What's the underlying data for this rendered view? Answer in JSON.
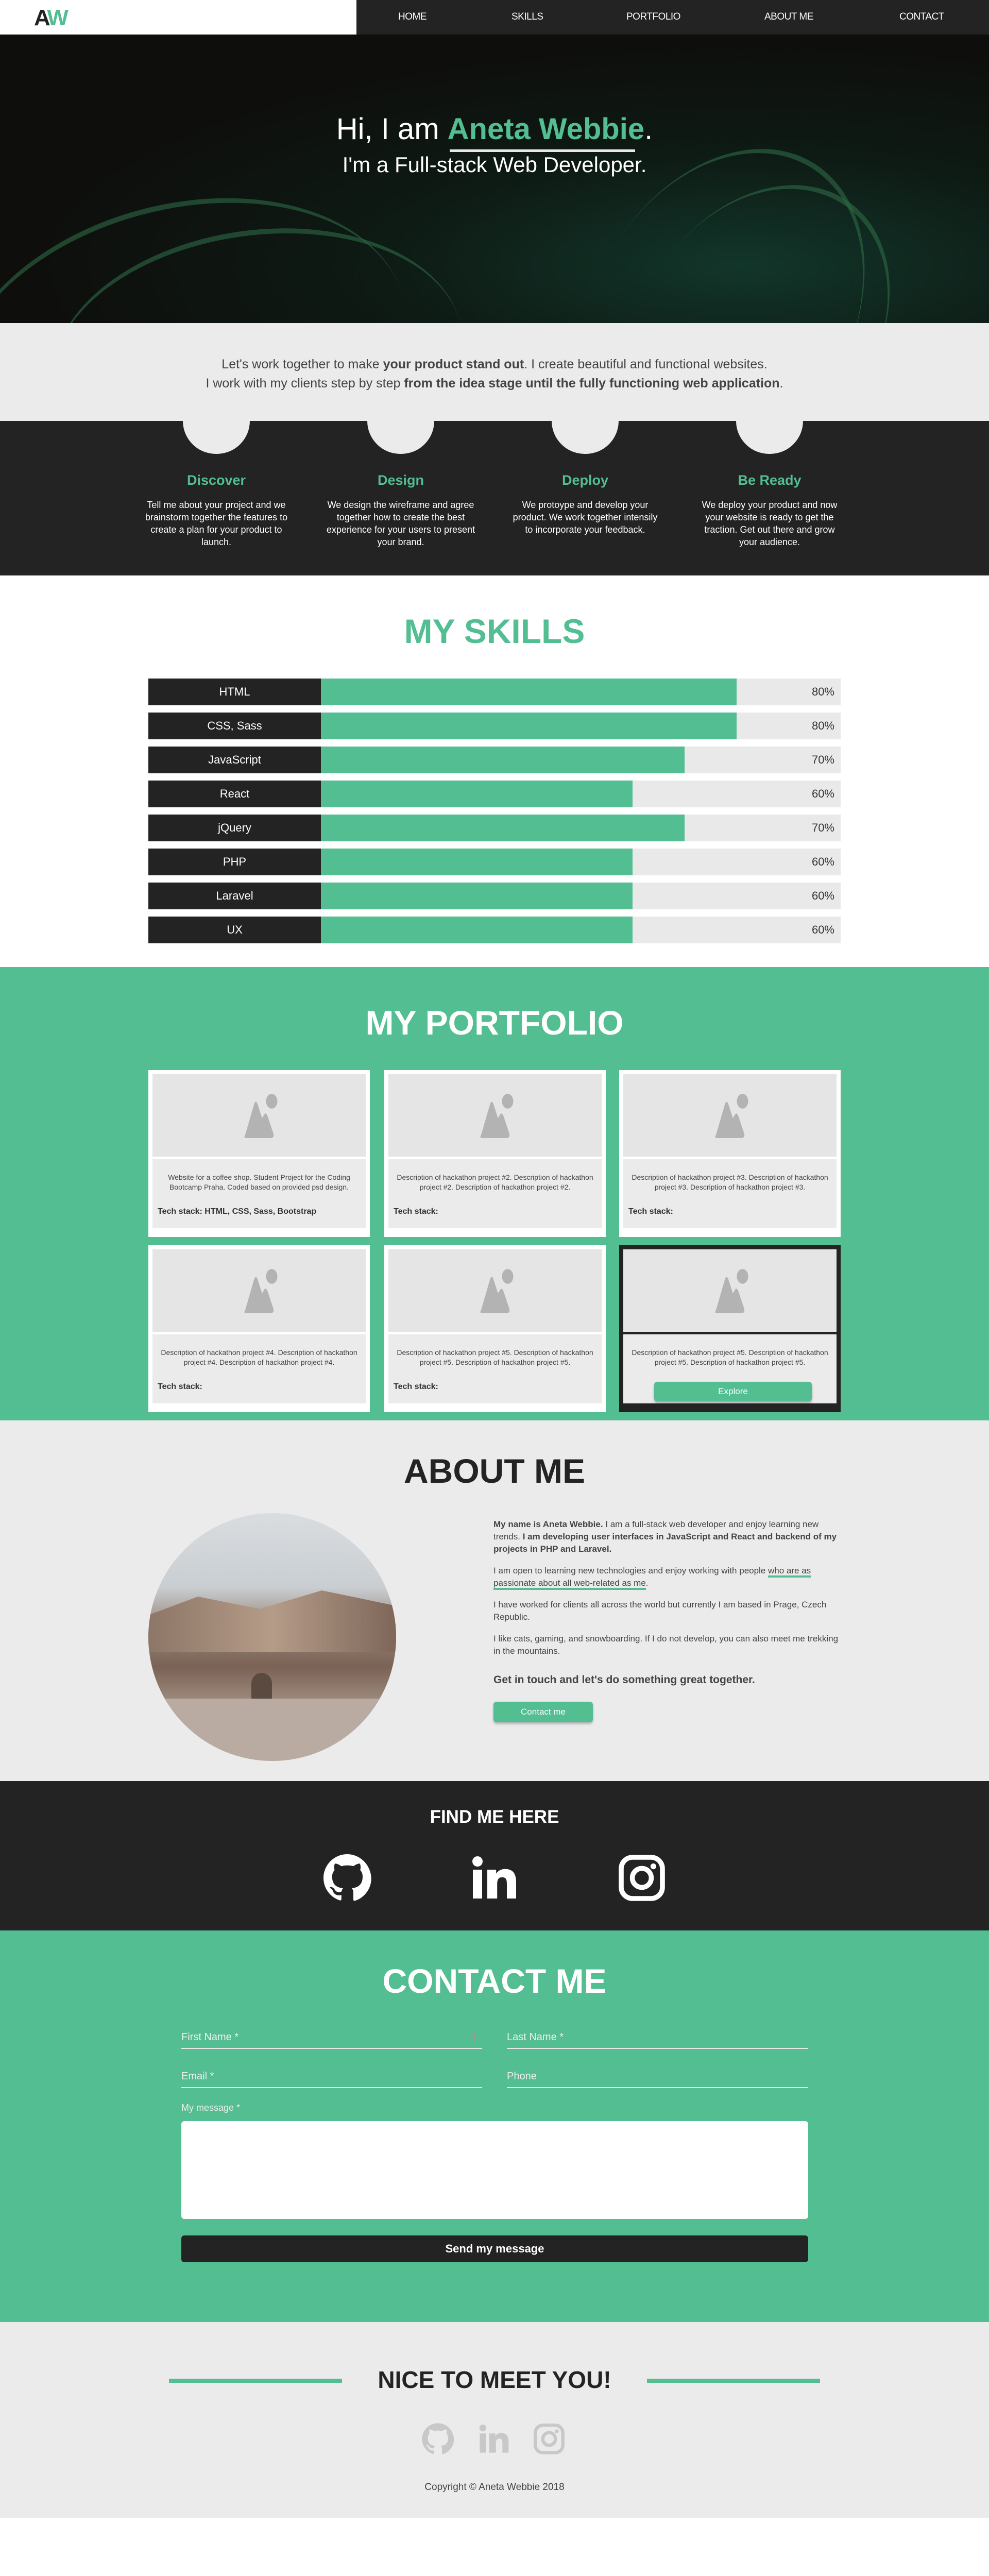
{
  "logo": {
    "a": "A",
    "w": "W"
  },
  "nav": [
    "HOME",
    "SKILLS",
    "PORTFOLIO",
    "ABOUT ME",
    "CONTACT"
  ],
  "hero": {
    "greeting": "Hi, I am ",
    "name": "Aneta Webbie",
    "period": ".",
    "subtitle": "I'm a Full-stack Web Developer."
  },
  "intro": {
    "line1": [
      {
        "t": "Let's work together to make "
      },
      {
        "t": "your product stand out",
        "b": true
      },
      {
        "t": ". I create beautiful and functional websites."
      }
    ],
    "line2": [
      {
        "t": "I work with my clients step by step "
      },
      {
        "t": "from the idea stage until the fully functioning web application",
        "b": true
      },
      {
        "t": "."
      }
    ]
  },
  "process": [
    {
      "title": "Discover",
      "text": "Tell me about your project and we brainstorm together the features to create a plan for your product to launch."
    },
    {
      "title": "Design",
      "text": "We design the wireframe and agree together how to create the best experience for your users to present your brand."
    },
    {
      "title": "Deploy",
      "text": "We protoype and develop your product. We work together intensily to incorporate your feedback."
    },
    {
      "title": "Be Ready",
      "text": "We deploy your product and now your website is ready to get the traction. Get out there and grow your audience."
    }
  ],
  "skills": {
    "title": "MY SKILLS",
    "items": [
      {
        "name": "HTML",
        "percent": 80,
        "label": "80%"
      },
      {
        "name": "CSS, Sass",
        "percent": 80,
        "label": "80%"
      },
      {
        "name": "JavaScript",
        "percent": 70,
        "label": "70%"
      },
      {
        "name": "React",
        "percent": 60,
        "label": "60%"
      },
      {
        "name": "jQuery",
        "percent": 70,
        "label": "70%"
      },
      {
        "name": "PHP",
        "percent": 60,
        "label": "60%"
      },
      {
        "name": "Laravel",
        "percent": 60,
        "label": "60%"
      },
      {
        "name": "UX",
        "percent": 60,
        "label": "60%"
      }
    ]
  },
  "portfolio": {
    "title": "MY PORTFOLIO",
    "cards": [
      {
        "desc": "Website for a coffee shop. Student Project for the Coding Bootcamp Praha. Coded based on provided psd design.",
        "tech": "Tech stack: HTML, CSS, Sass, Bootstrap"
      },
      {
        "desc": "Description of hackathon project #2. Description of hackathon project #2. Description of hackathon project #2.",
        "tech": "Tech stack:"
      },
      {
        "desc": "Description of hackathon project #3. Description of hackathon project #3. Description of hackathon project #3.",
        "tech": "Tech stack:"
      },
      {
        "desc": "Description of hackathon project #4. Description of hackathon project #4. Description of hackathon project #4.",
        "tech": "Tech stack:"
      },
      {
        "desc": "Description of hackathon project #5. Description of hackathon project #5. Description of hackathon project #5.",
        "tech": "Tech stack:"
      },
      {
        "desc": "Description of hackathon project #5. Description of hackathon project #5. Description of hackathon project #5.",
        "button": "Explore",
        "hovered": true
      }
    ]
  },
  "about": {
    "title": "ABOUT ME",
    "p1": [
      {
        "t": "My name is Aneta Webbie.",
        "b": true
      },
      {
        "t": " I am a full-stack web developer and enjoy learning new trends. "
      },
      {
        "t": "I am developing user interfaces in JavaScript and React and backend of my projects in PHP and Laravel.",
        "b": true
      }
    ],
    "p2": [
      {
        "t": "I am open to learning new technologies and enjoy working with people "
      },
      {
        "t": "who are as passionate about all web-related as me",
        "u": true
      },
      {
        "t": "."
      }
    ],
    "p3": "I have worked for clients all across the world but currently I am based in Prage, Czech Republic.",
    "p4": "I like cats, gaming, and snowboarding. If I do not develop, you can also meet me trekking in the mountains.",
    "cta": "Get in touch and let's do something great together.",
    "button": "Contact me"
  },
  "find": {
    "title": "FIND ME HERE",
    "icons": [
      "github-icon",
      "linkedin-icon",
      "instagram-icon"
    ]
  },
  "contact": {
    "title": "CONTACT ME",
    "first_name": "First Name *",
    "last_name": "Last Name *",
    "email": "Email *",
    "phone": "Phone",
    "message_label": "My message *",
    "message_value": "",
    "send": "Send my message"
  },
  "footer": {
    "title": "NICE TO MEET YOU!",
    "copyright": "Copyright © Aneta Webbie 2018"
  },
  "colors": {
    "accent": "#53be91",
    "dark": "#232323",
    "light": "#ebebeb"
  }
}
